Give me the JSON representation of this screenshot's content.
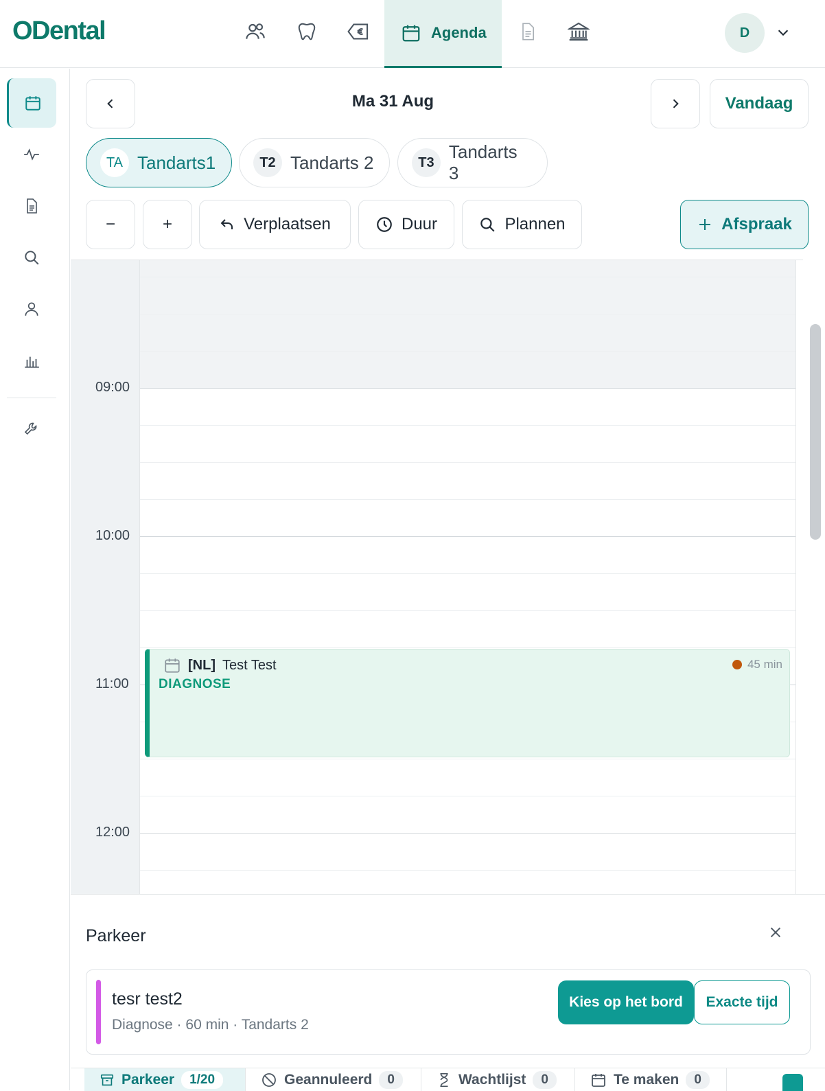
{
  "app": {
    "logo": "ODental"
  },
  "topnav": {
    "icons": [
      "users-icon",
      "tooth-icon",
      "invoice-euro-icon",
      "calendar-icon",
      "document-icon",
      "bank-icon"
    ],
    "active_label": "Agenda",
    "user_initial": "D"
  },
  "sidebar": {
    "items": [
      "calendar-icon",
      "activity-icon",
      "document-icon",
      "search-icon",
      "user-icon",
      "chart-icon",
      "wrench-icon"
    ],
    "active": "calendar-icon"
  },
  "header": {
    "date": "Ma 31 Aug",
    "today_label": "Vandaag"
  },
  "dentists": [
    {
      "badge": "TA",
      "name": "Tandarts1",
      "active": true
    },
    {
      "badge": "T2",
      "name": "Tandarts 2",
      "active": false
    },
    {
      "badge": "T3",
      "name": "Tandarts 3",
      "active": false
    }
  ],
  "toolbar": {
    "zoom_out": "−",
    "zoom_in": "+",
    "move_label": "Verplaatsen",
    "duration_label": "Duur",
    "plan_label": "Plannen",
    "new_appointment_label": "Afspraak"
  },
  "calendar": {
    "hours": [
      "09:00",
      "10:00",
      "11:00",
      "12:00"
    ],
    "appointment": {
      "tag": "[NL]",
      "patient": "Test Test",
      "type": "DIAGNOSE",
      "duration": "45 min",
      "status_color": "#c0580c"
    }
  },
  "park": {
    "title": "Parkeer",
    "item": {
      "name": "tesr test2",
      "details": "Diagnose · 60 min · Tandarts 2",
      "choose_label": "Kies op het bord",
      "exact_label": "Exacte tijd",
      "color": "#d35ae6"
    }
  },
  "tabs": [
    {
      "label": "Parkeer",
      "count": "1/20",
      "icon": "archive-icon",
      "active": true
    },
    {
      "label": "Geannuleerd",
      "count": "0",
      "icon": "ban-icon",
      "active": false
    },
    {
      "label": "Wachtlijst",
      "count": "0",
      "icon": "hourglass-icon",
      "active": false
    },
    {
      "label": "Te maken",
      "count": "0",
      "icon": "calendar-icon",
      "active": false
    }
  ],
  "colors": {
    "brand": "#0e7a6a",
    "accent": "#0e9a93",
    "appointment_bg": "#e6f6ef"
  }
}
